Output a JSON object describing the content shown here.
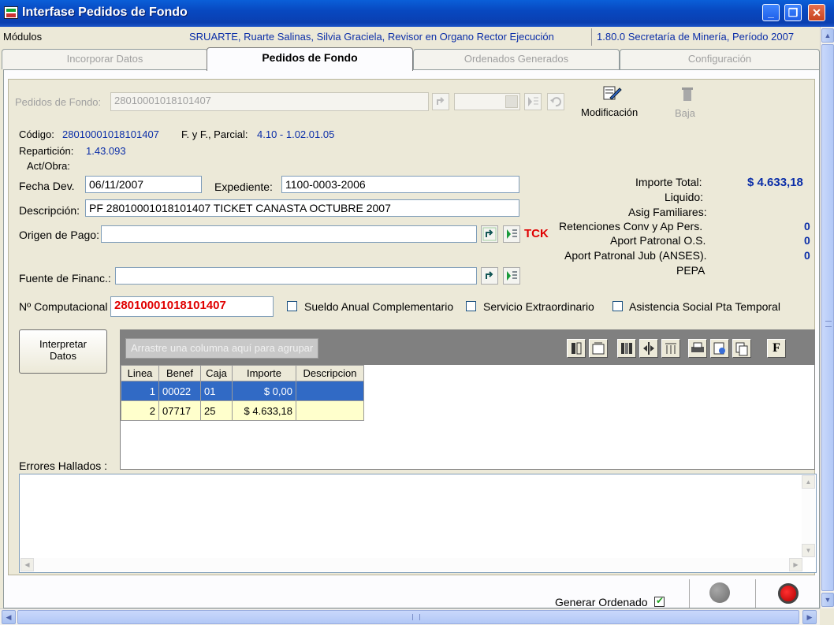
{
  "window": {
    "title": "Interfase Pedidos de Fondo"
  },
  "infostrip": {
    "modulos": "Módulos",
    "user": "SRUARTE, Ruarte Salinas, Silvia Graciela, Revisor en Organo Rector Ejecución",
    "version": "1.80.0 Secretaría de Minería, Período 2007"
  },
  "tabs": [
    "Incorporar Datos",
    "Pedidos de Fondo",
    "Ordenados Generados",
    "Configuración"
  ],
  "header": {
    "pedidos_label": "Pedidos de Fondo:",
    "pedidos_value": "28010001018101407",
    "modificacion_label": "Modificación",
    "baja_label": "Baja"
  },
  "info": {
    "codigo_label": "Código:",
    "codigo_value": "28010001018101407",
    "fyf_label": "F. y F., Parcial:",
    "fyf_value": "4.10 - 1.02.01.05",
    "reparticion_label": "Repartición:",
    "reparticion_value": "1.43.093",
    "actobra_label": "Act/Obra:"
  },
  "form": {
    "fecha_label": "Fecha Dev.",
    "fecha_value": "06/11/2007",
    "expediente_label": "Expediente:",
    "expediente_value": "1100-0003-2006",
    "descripcion_label": "Descripción:",
    "descripcion_value": "PF 28010001018101407 TICKET CANASTA OCTUBRE 2007",
    "origen_label": "Origen de Pago:",
    "origen_value": "",
    "tck_label": "TCK",
    "fuente_label": "Fuente de Financ.:",
    "fuente_value": "",
    "computacional_label": "Nº Computacional",
    "computacional_value": "28010001018101407",
    "sueldo_label": "Sueldo Anual Complementario",
    "servicio_label": "Servicio Extraordinario",
    "asistencia_label": "Asistencia Social Pta Temporal"
  },
  "totals": {
    "importe_total_label": "Importe Total:",
    "importe_total_value": "$ 4.633,18",
    "liquido_label": "Liquido:",
    "asig_label": "Asig Familiares:",
    "retenciones_label": "Retenciones Conv y Ap Pers.",
    "retenciones_value": "0",
    "aport_os_label": "Aport Patronal O.S.",
    "aport_os_value": "0",
    "aport_jub_label": "Aport Patronal Jub (ANSES).",
    "aport_jub_value": "0",
    "pepa_label": "PEPA"
  },
  "interpretar": {
    "line1": "Interpretar",
    "line2": "Datos"
  },
  "grid": {
    "group_placeholder": "Arrastre una columna aquí para agrupar",
    "columns": [
      "Linea",
      "Benef",
      "Caja",
      "Importe",
      "Descripcion"
    ],
    "rows": [
      {
        "linea": "1",
        "benef": "00022",
        "caja": "01",
        "importe": "$ 0,00",
        "descripcion": ""
      },
      {
        "linea": "2",
        "benef": "07717",
        "caja": "25",
        "importe": "$ 4.633,18",
        "descripcion": ""
      }
    ],
    "tool_f_label": "F"
  },
  "errors": {
    "label": "Errores Hallados :"
  },
  "bottom": {
    "generar_label": "Generar Ordenado"
  },
  "colors": {
    "accent_blue": "#0b2ea8",
    "red": "#e00000",
    "selected_row": "#316ac5"
  }
}
